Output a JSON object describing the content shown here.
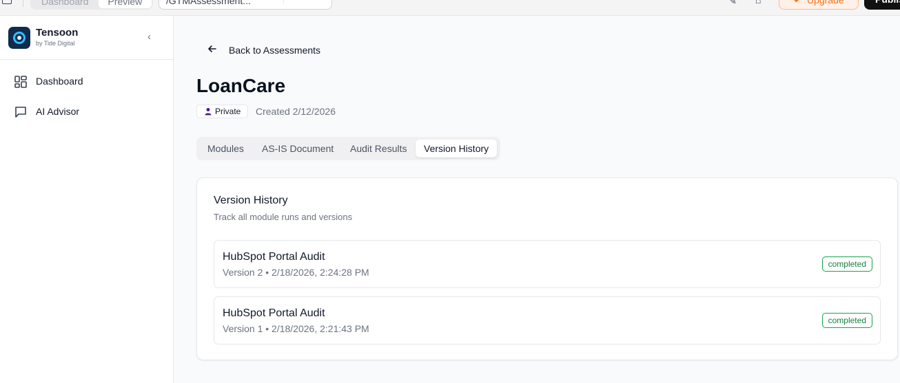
{
  "topbar": {
    "segments": [
      "Dashboard",
      "Preview"
    ],
    "url": "/GTMAssessment..."
  },
  "sidebar": {
    "brand_name": "Tensoon",
    "brand_sub": "by Tide Digital",
    "items": [
      {
        "label": "Dashboard",
        "icon": "dashboard-grid-icon"
      },
      {
        "label": "AI Advisor",
        "icon": "chat-bubble-icon"
      }
    ]
  },
  "main": {
    "back_label": "Back to Assessments",
    "title": "LoanCare",
    "visibility": "Private",
    "created": "Created 2/12/2026",
    "tabs": [
      "Modules",
      "AS-IS Document",
      "Audit Results",
      "Version History"
    ],
    "active_tab": "Version History",
    "card": {
      "title": "Version History",
      "subtitle": "Track all module runs and versions",
      "versions": [
        {
          "name": "HubSpot Portal Audit",
          "meta": "Version 2 • 2/18/2026, 2:24:28 PM",
          "status": "completed"
        },
        {
          "name": "HubSpot Portal Audit",
          "meta": "Version 1 • 2/18/2026, 2:21:43 PM",
          "status": "completed"
        }
      ]
    }
  },
  "colors": {
    "status_completed": "#16a34a",
    "active_tab_bg": "#ffffff",
    "upgrade_accent": "#f97316"
  }
}
